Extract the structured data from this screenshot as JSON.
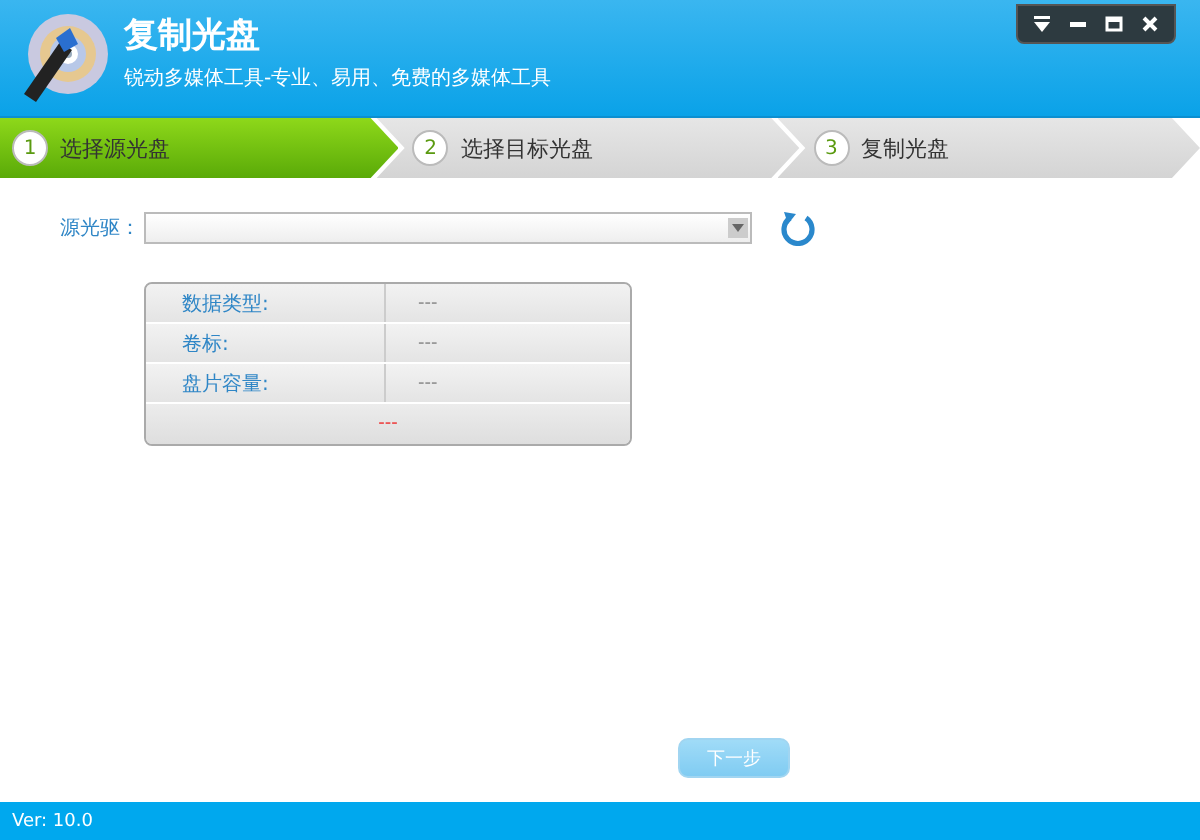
{
  "window": {
    "title": "复制光盘",
    "subtitle": "锐动多媒体工具-专业、易用、免费的多媒体工具"
  },
  "steps": [
    {
      "number": "1",
      "label": "选择源光盘",
      "selected": true
    },
    {
      "number": "2",
      "label": "选择目标光盘",
      "selected": false
    },
    {
      "number": "3",
      "label": "复制光盘",
      "selected": false
    }
  ],
  "source": {
    "label": "源光驱："
  },
  "info": {
    "rows": [
      {
        "label": "数据类型:",
        "value": "---"
      },
      {
        "label": "卷标:",
        "value": "---"
      },
      {
        "label": "盘片容量:",
        "value": "---"
      }
    ],
    "footer": "---"
  },
  "next_button": {
    "label": "下一步",
    "disabled": true
  },
  "status_bar": "Ver: 10.0"
}
